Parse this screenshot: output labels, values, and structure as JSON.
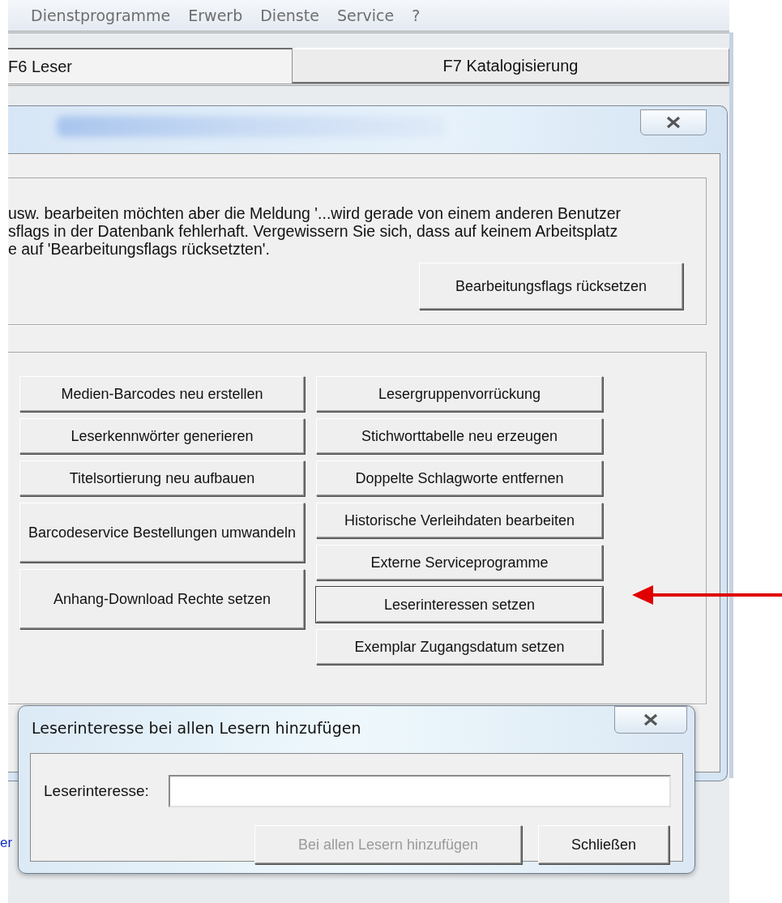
{
  "menu": [
    {
      "label": "Dienstprogramme"
    },
    {
      "label": "Erwerb"
    },
    {
      "label": "Dienste"
    },
    {
      "label": "Service"
    },
    {
      "label": "?"
    }
  ],
  "tabs": [
    {
      "label": "F6 Leser",
      "selected": true
    },
    {
      "label": "F7 Katalogisierung",
      "selected": false
    }
  ],
  "service_window": {
    "message_lines": [
      "usw. bearbeiten möchten aber die Meldung '...wird gerade von einem anderen Benutzer",
      "sflags in der Datenbank fehlerhaft. Vergewissern Sie sich, dass auf keinem Arbeitsplatz",
      "e auf 'Bearbeitungsflags rücksetzten'."
    ],
    "reset_button": "Bearbeitungsflags rücksetzen",
    "left_buttons": [
      {
        "label": "Medien-Barcodes neu erstellen",
        "focused": false
      },
      {
        "label": "Leserkennwörter generieren",
        "focused": false
      },
      {
        "label": "Titelsortierung neu aufbauen",
        "focused": false
      },
      {
        "label": "Barcodeservice Bestellungen umwandeln",
        "focused": false
      },
      {
        "label": "Anhang-Download Rechte setzen",
        "focused": false
      }
    ],
    "right_buttons": [
      {
        "label": "Lesergruppenvorrückung",
        "focused": false
      },
      {
        "label": "Stichworttabelle neu erzeugen",
        "focused": false
      },
      {
        "label": "Doppelte Schlagworte entfernen",
        "focused": false
      },
      {
        "label": "Historische Verleihdaten bearbeiten",
        "focused": false
      },
      {
        "label": "Externe Serviceprogramme",
        "focused": false
      },
      {
        "label": "Leserinteressen setzen",
        "focused": true
      },
      {
        "label": "Exemplar Zugangsdatum setzen",
        "focused": false
      }
    ]
  },
  "background_link": "er",
  "dialog": {
    "title": "Leserinteresse bei allen Lesern hinzufügen",
    "field_label": "Leserinteresse:",
    "buttons": [
      {
        "label": "Bei allen Lesern hinzufügen",
        "disabled": true
      },
      {
        "label": "Schließen",
        "disabled": false
      }
    ]
  }
}
